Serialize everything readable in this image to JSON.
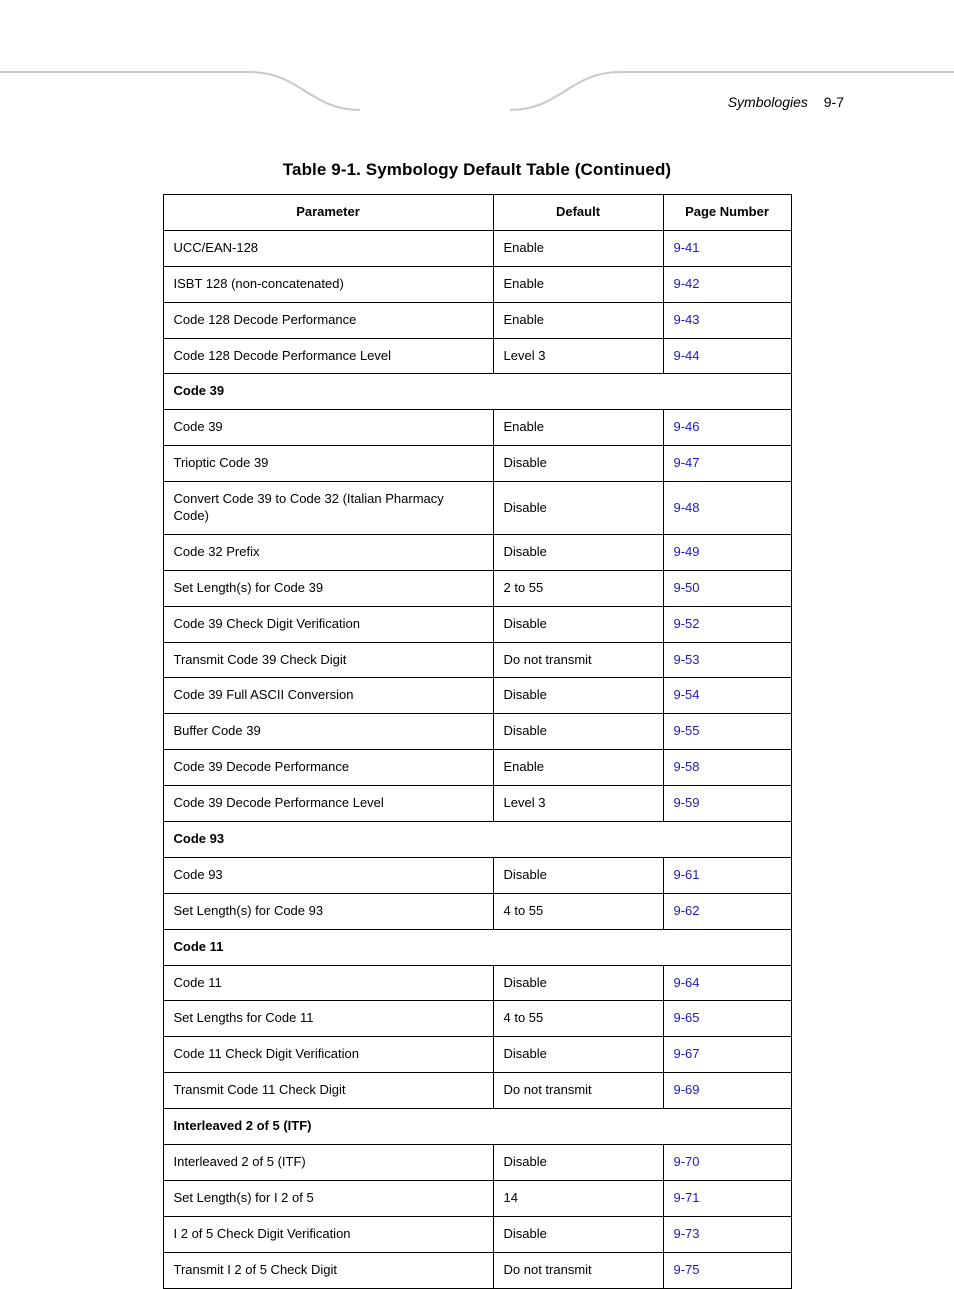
{
  "running_head": {
    "section": "Symbologies",
    "page": "9-7"
  },
  "caption": "Table 9-1. Symbology Default Table (Continued)",
  "columns": {
    "c1": "Parameter",
    "c2": "Default",
    "c3": "Page Number"
  },
  "rows": [
    {
      "type": "data",
      "param": "UCC/EAN-128",
      "default": "Enable",
      "page": "9-41"
    },
    {
      "type": "data",
      "param": "ISBT 128 (non-concatenated)",
      "default": "Enable",
      "page": "9-42"
    },
    {
      "type": "data",
      "param": "Code 128 Decode Performance",
      "default": "Enable",
      "page": "9-43"
    },
    {
      "type": "data",
      "param": "Code 128 Decode Performance Level",
      "default": "Level 3",
      "page": "9-44"
    },
    {
      "type": "section",
      "param": "Code 39"
    },
    {
      "type": "data",
      "param": "Code 39",
      "default": "Enable",
      "page": "9-46"
    },
    {
      "type": "data",
      "param": "Trioptic Code 39",
      "default": "Disable",
      "page": "9-47"
    },
    {
      "type": "data",
      "param": "Convert Code 39 to Code 32 (Italian Pharmacy Code)",
      "default": "Disable",
      "page": "9-48"
    },
    {
      "type": "data",
      "param": "Code 32 Prefix",
      "default": "Disable",
      "page": "9-49"
    },
    {
      "type": "data",
      "param": "Set Length(s) for Code 39",
      "default": "2 to 55",
      "page": "9-50"
    },
    {
      "type": "data",
      "param": "Code 39 Check Digit Verification",
      "default": "Disable",
      "page": "9-52"
    },
    {
      "type": "data",
      "param": "Transmit Code 39 Check Digit",
      "default": "Do not transmit",
      "page": "9-53"
    },
    {
      "type": "data",
      "param": "Code 39 Full ASCII Conversion",
      "default": "Disable",
      "page": "9-54"
    },
    {
      "type": "data",
      "param": "Buffer Code 39",
      "default": "Disable",
      "page": "9-55"
    },
    {
      "type": "data",
      "param": "Code 39 Decode Performance",
      "default": "Enable",
      "page": "9-58"
    },
    {
      "type": "data",
      "param": "Code 39 Decode Performance Level",
      "default": "Level 3",
      "page": "9-59"
    },
    {
      "type": "section",
      "param": "Code 93"
    },
    {
      "type": "data",
      "param": "Code 93",
      "default": "Disable",
      "page": "9-61"
    },
    {
      "type": "data",
      "param": "Set Length(s) for Code 93",
      "default": "4 to 55",
      "page": "9-62"
    },
    {
      "type": "section",
      "param": "Code 11"
    },
    {
      "type": "data",
      "param": "Code 11",
      "default": "Disable",
      "page": "9-64"
    },
    {
      "type": "data",
      "param": "Set Lengths for Code 11",
      "default": "4 to 55",
      "page": "9-65"
    },
    {
      "type": "data",
      "param": "Code 11 Check Digit Verification",
      "default": "Disable",
      "page": "9-67"
    },
    {
      "type": "data",
      "param": "Transmit Code 11 Check Digit",
      "default": "Do not transmit",
      "page": "9-69"
    },
    {
      "type": "section",
      "param": "Interleaved 2 of 5 (ITF)"
    },
    {
      "type": "data",
      "param": "Interleaved 2 of 5 (ITF)",
      "default": "Disable",
      "page": "9-70"
    },
    {
      "type": "data",
      "param": "Set Length(s) for I 2 of 5",
      "default": "14",
      "page": "9-71"
    },
    {
      "type": "data",
      "param": "I 2 of 5 Check Digit Verification",
      "default": "Disable",
      "page": "9-73"
    },
    {
      "type": "data",
      "param": "Transmit I 2 of 5 Check Digit",
      "default": "Do not transmit",
      "page": "9-75"
    }
  ]
}
